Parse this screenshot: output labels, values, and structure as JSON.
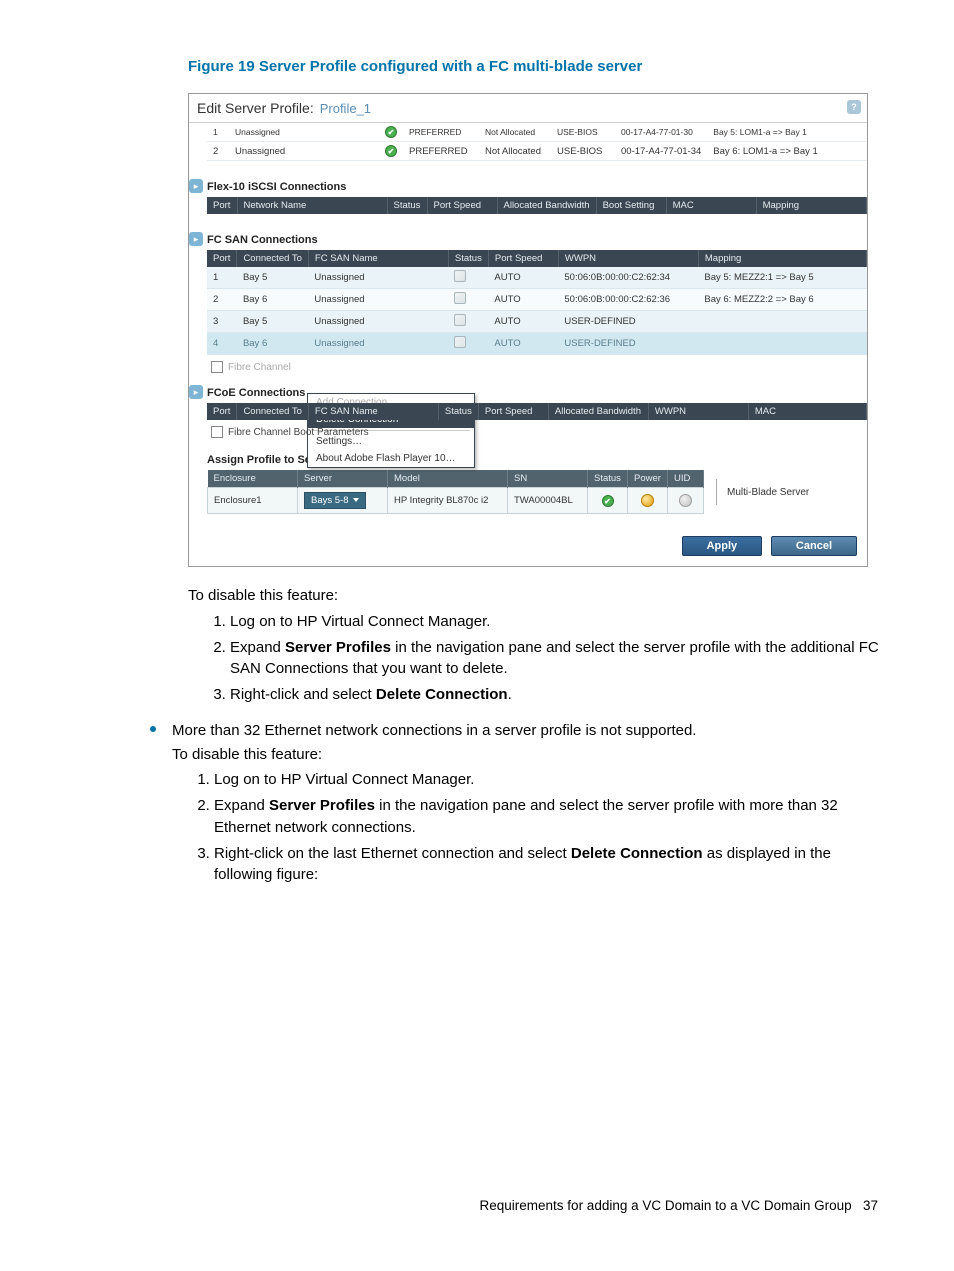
{
  "figure_caption": "Figure 19 Server Profile configured with a FC multi-blade server",
  "editor": {
    "title_main": "Edit Server Profile:",
    "title_sub": "Profile_1",
    "help_glyph": "?"
  },
  "eth_headers": {
    "port_speed": "Port Speed"
  },
  "eth_rows": [
    {
      "port": "1",
      "name": "Unassigned",
      "speed": "PREFERRED",
      "band": "Not Allocated",
      "boot": "USE-BIOS",
      "mac": "00-17-A4-77-01-30",
      "mapping": "Bay 5: LOM1-a => Bay 1"
    },
    {
      "port": "2",
      "name": "Unassigned",
      "speed": "PREFERRED",
      "band": "Not Allocated",
      "boot": "USE-BIOS",
      "mac": "00-17-A4-77-01-34",
      "mapping": "Bay 6: LOM1-a => Bay 1"
    }
  ],
  "iscsi": {
    "title": "Flex-10 iSCSI Connections",
    "headers": {
      "port": "Port",
      "net": "Network Name",
      "status": "Status",
      "speed": "Port Speed",
      "band": "Allocated Bandwidth",
      "boot": "Boot Setting",
      "mac": "MAC",
      "map": "Mapping"
    }
  },
  "fcsan": {
    "title": "FC SAN Connections",
    "headers": {
      "port": "Port",
      "conn": "Connected To",
      "name": "FC SAN Name",
      "status": "Status",
      "speed": "Port Speed",
      "wwpn": "WWPN",
      "map": "Mapping"
    },
    "rows": [
      {
        "port": "1",
        "conn": "Bay 5",
        "name": "Unassigned",
        "speed": "AUTO",
        "wwpn": "50:06:0B:00:00:C2:62:34",
        "map": "Bay 5: MEZZ2:1 => Bay 5"
      },
      {
        "port": "2",
        "conn": "Bay 6",
        "name": "Unassigned",
        "speed": "AUTO",
        "wwpn": "50:06:0B:00:00:C2:62:36",
        "map": "Bay 6: MEZZ2:2 => Bay 6"
      },
      {
        "port": "3",
        "conn": "Bay 5",
        "name": "Unassigned",
        "speed": "AUTO",
        "wwpn": "USER-DEFINED",
        "map": ""
      },
      {
        "port": "4",
        "conn": "Bay 6",
        "name": "Unassigned",
        "speed": "AUTO",
        "wwpn": "USER-DEFINED",
        "map": ""
      }
    ],
    "fc_boot_chk": "Fibre Channel Boot Parameters"
  },
  "context_menu": {
    "add": "Add Connection",
    "delete": "Delete Connection",
    "settings": "Settings…",
    "about": "About Adobe Flash Player 10…"
  },
  "fcoe": {
    "title": "FCoE Connections",
    "headers": {
      "port": "Port",
      "conn": "Connected To",
      "name": "FC SAN Name",
      "status": "Status",
      "speed": "Port Speed",
      "band": "Allocated Bandwidth",
      "wwpn": "WWPN",
      "mac": "MAC"
    },
    "fc_boot_chk": "Fibre Channel Boot Parameters"
  },
  "assign": {
    "title": "Assign Profile to Server Bay",
    "headers": {
      "enc": "Enclosure",
      "srv": "Server",
      "model": "Model",
      "sn": "SN",
      "status": "Status",
      "power": "Power",
      "uid": "UID"
    },
    "row": {
      "enc": "Enclosure1",
      "srv": "Bays 5-8",
      "model": "HP Integrity BL870c i2",
      "sn": "TWA00004BL"
    },
    "mbs_label": "Multi-Blade Server"
  },
  "buttons": {
    "apply": "Apply",
    "cancel": "Cancel"
  },
  "body": {
    "disable_intro": "To disable this feature:",
    "steps1": {
      "s1": "Log on to HP Virtual Connect Manager.",
      "s2a": "Expand ",
      "s2b": "Server Profiles",
      "s2c": " in the navigation pane and select the server profile with the additional FC SAN Connections that you want to delete.",
      "s3a": "Right-click and select ",
      "s3b": "Delete Connection",
      "s3c": "."
    },
    "bullet": "More than 32 Ethernet network connections in a server profile is not supported.",
    "steps2": {
      "s1": "Log on to HP Virtual Connect Manager.",
      "s2a": "Expand ",
      "s2b": "Server Profiles",
      "s2c": " in the navigation pane and select the server profile with more than 32 Ethernet network connections.",
      "s3a": "Right-click on the last Ethernet connection and select ",
      "s3b": "Delete Connection",
      "s3c": " as displayed in the following figure:"
    }
  },
  "footer": {
    "text": "Requirements for adding a VC Domain to a VC Domain Group",
    "page": "37"
  }
}
